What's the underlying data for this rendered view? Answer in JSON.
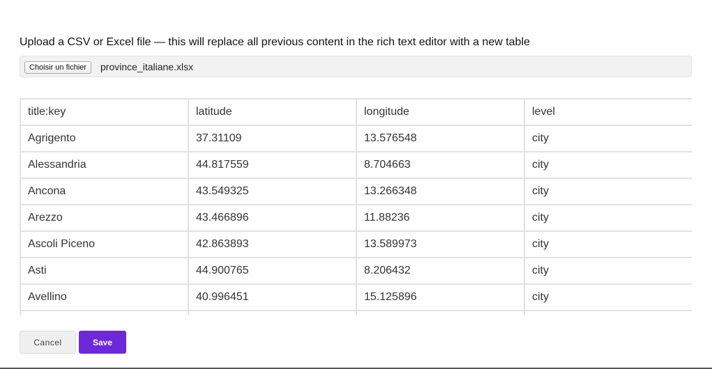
{
  "instruction": "Upload a CSV or Excel file — this will replace all previous content in the rich text editor with a new table",
  "file_input": {
    "button_label": "Choisir un fichier",
    "file_name": "province_italiane.xlsx"
  },
  "table": {
    "rows": [
      [
        "title:key",
        "latitude",
        "longitude",
        "level"
      ],
      [
        "Agrigento",
        "37.31109",
        "13.576548",
        "city"
      ],
      [
        "Alessandria",
        "44.817559",
        "8.704663",
        "city"
      ],
      [
        "Ancona",
        "43.549325",
        "13.266348",
        "city"
      ],
      [
        "Arezzo",
        "43.466896",
        "11.88236",
        "city"
      ],
      [
        "Ascoli Piceno",
        "42.863893",
        "13.589973",
        "city"
      ],
      [
        "Asti",
        "44.900765",
        "8.206432",
        "city"
      ],
      [
        "Avellino",
        "40.996451",
        "15.125896",
        "city"
      ]
    ]
  },
  "actions": {
    "cancel_label": "Cancel",
    "save_label": "Save",
    "save_color": "#6d28d9"
  }
}
